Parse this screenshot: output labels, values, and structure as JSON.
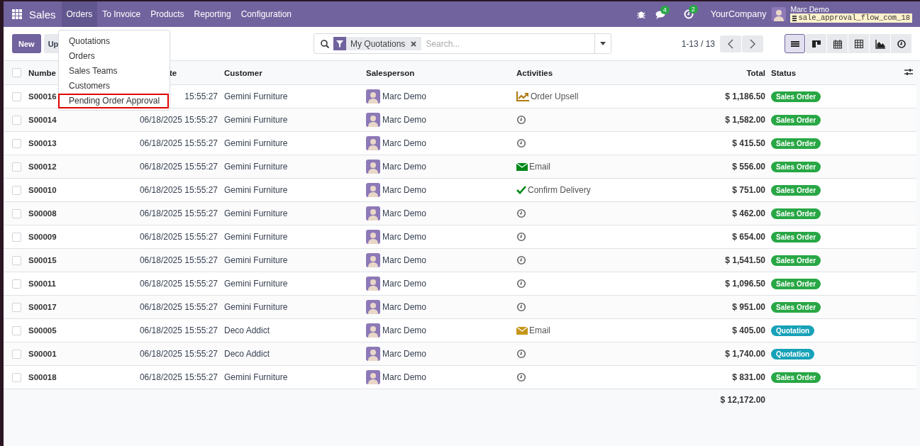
{
  "navbar": {
    "brand": "Sales",
    "menu": [
      {
        "label": "Orders",
        "selected": true
      },
      {
        "label": "To Invoice",
        "selected": false
      },
      {
        "label": "Products",
        "selected": false
      },
      {
        "label": "Reporting",
        "selected": false
      },
      {
        "label": "Configuration",
        "selected": false
      }
    ],
    "messages_count": "4",
    "activities_count": "2",
    "company": "YourCompany",
    "user": {
      "name": "Marc Demo",
      "database": "sale_approval_flow_com_18"
    }
  },
  "orders_menu": {
    "items": [
      {
        "label": "Quotations",
        "annotated": false
      },
      {
        "label": "Orders",
        "annotated": false
      },
      {
        "label": "Sales Teams",
        "annotated": false
      },
      {
        "label": "Customers",
        "annotated": false
      },
      {
        "label": "Pending Order Approval",
        "annotated": true
      }
    ]
  },
  "control_panel": {
    "buttons": [
      {
        "label": "New",
        "kind": "primary"
      },
      {
        "label": "Up",
        "kind": "secondary"
      }
    ],
    "search": {
      "facet": "My Quotations",
      "placeholder": "Search..."
    },
    "pager": "1-13 / 13",
    "views": [
      {
        "kind": "list",
        "selected": true
      },
      {
        "kind": "kanban",
        "selected": false
      },
      {
        "kind": "calendar",
        "selected": false
      },
      {
        "kind": "pivot",
        "selected": false
      },
      {
        "kind": "graph",
        "selected": false
      },
      {
        "kind": "activity",
        "selected": false
      }
    ]
  },
  "table": {
    "select_all": {
      "checked": false
    },
    "columns": [
      "Numbe",
      "te",
      "Customer",
      "Salesperson",
      "Activities",
      "Total",
      "Status"
    ],
    "rows": [
      {
        "selected": false,
        "number": "S00016",
        "order_date": "15:55:27",
        "customer": "Gemini Furniture",
        "salesperson": "Marc Demo",
        "activity": {
          "kind": "upsell",
          "label": "Order Upsell",
          "color": "#b07a14"
        },
        "total": "$ 1,186.50",
        "status": {
          "label": "Sales Order",
          "color": "#28a745"
        }
      },
      {
        "selected": false,
        "number": "S00014",
        "order_date": "06/18/2025 15:55:27",
        "customer": "Gemini Furniture",
        "salesperson": "Marc Demo",
        "activity": {
          "kind": "clock"
        },
        "total": "$ 1,582.00",
        "status": {
          "label": "Sales Order",
          "color": "#28a745"
        }
      },
      {
        "selected": false,
        "number": "S00013",
        "order_date": "06/18/2025 15:55:27",
        "customer": "Gemini Furniture",
        "salesperson": "Marc Demo",
        "activity": {
          "kind": "clock"
        },
        "total": "$ 415.50",
        "status": {
          "label": "Sales Order",
          "color": "#28a745"
        }
      },
      {
        "selected": false,
        "number": "S00012",
        "order_date": "06/18/2025 15:55:27",
        "customer": "Gemini Furniture",
        "salesperson": "Marc Demo",
        "activity": {
          "kind": "email",
          "label": "Email",
          "color": "#008818"
        },
        "total": "$ 556.00",
        "status": {
          "label": "Sales Order",
          "color": "#28a745"
        }
      },
      {
        "selected": false,
        "number": "S00010",
        "order_date": "06/18/2025 15:55:27",
        "customer": "Gemini Furniture",
        "salesperson": "Marc Demo",
        "activity": {
          "kind": "check",
          "label": "Confirm Delivery",
          "color": "#008818"
        },
        "total": "$ 751.00",
        "status": {
          "label": "Sales Order",
          "color": "#28a745"
        }
      },
      {
        "selected": false,
        "number": "S00008",
        "order_date": "06/18/2025 15:55:27",
        "customer": "Gemini Furniture",
        "salesperson": "Marc Demo",
        "activity": {
          "kind": "clock"
        },
        "total": "$ 462.00",
        "status": {
          "label": "Sales Order",
          "color": "#28a745"
        }
      },
      {
        "selected": false,
        "number": "S00009",
        "order_date": "06/18/2025 15:55:27",
        "customer": "Gemini Furniture",
        "salesperson": "Marc Demo",
        "activity": {
          "kind": "clock"
        },
        "total": "$ 654.00",
        "status": {
          "label": "Sales Order",
          "color": "#28a745"
        }
      },
      {
        "selected": false,
        "number": "S00015",
        "order_date": "06/18/2025 15:55:27",
        "customer": "Gemini Furniture",
        "salesperson": "Marc Demo",
        "activity": {
          "kind": "clock"
        },
        "total": "$ 1,541.50",
        "status": {
          "label": "Sales Order",
          "color": "#28a745"
        }
      },
      {
        "selected": false,
        "number": "S00011",
        "order_date": "06/18/2025 15:55:27",
        "customer": "Gemini Furniture",
        "salesperson": "Marc Demo",
        "activity": {
          "kind": "clock"
        },
        "total": "$ 1,096.50",
        "status": {
          "label": "Sales Order",
          "color": "#28a745"
        }
      },
      {
        "selected": false,
        "number": "S00017",
        "order_date": "06/18/2025 15:55:27",
        "customer": "Gemini Furniture",
        "salesperson": "Marc Demo",
        "activity": {
          "kind": "clock"
        },
        "total": "$ 951.00",
        "status": {
          "label": "Sales Order",
          "color": "#28a745"
        }
      },
      {
        "selected": false,
        "number": "S00005",
        "order_date": "06/18/2025 15:55:27",
        "customer": "Deco Addict",
        "salesperson": "Marc Demo",
        "activity": {
          "kind": "email",
          "label": "Email",
          "color": "#c4961a"
        },
        "total": "$ 405.00",
        "status": {
          "label": "Quotation",
          "color": "#17a2b8"
        }
      },
      {
        "selected": false,
        "number": "S00001",
        "order_date": "06/18/2025 15:55:27",
        "customer": "Deco Addict",
        "salesperson": "Marc Demo",
        "activity": {
          "kind": "clock"
        },
        "total": "$ 1,740.00",
        "status": {
          "label": "Quotation",
          "color": "#17a2b8"
        }
      },
      {
        "selected": false,
        "number": "S00018",
        "order_date": "06/18/2025 15:55:27",
        "customer": "Gemini Furniture",
        "salesperson": "Marc Demo",
        "activity": {
          "kind": "clock"
        },
        "total": "$ 831.00",
        "status": {
          "label": "Sales Order",
          "color": "#28a745"
        }
      }
    ],
    "sum_total": "$ 12,172.00"
  }
}
